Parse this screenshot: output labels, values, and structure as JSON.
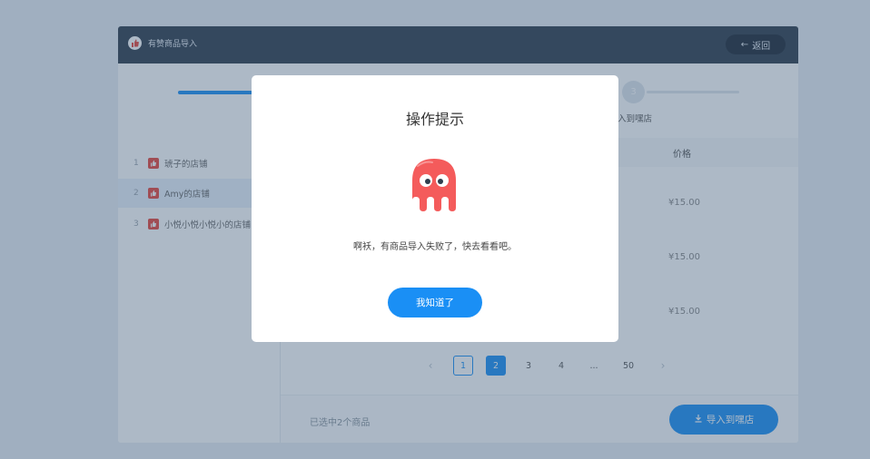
{
  "app": {
    "title": "有赞商品导入",
    "back_label": "返回"
  },
  "stepper": {
    "step3_number": "3",
    "step3_label": "入到嘿店"
  },
  "stores": [
    {
      "num": "1",
      "name": "琥子的店铺"
    },
    {
      "num": "2",
      "name": "Amy的店铺"
    },
    {
      "num": "3",
      "name": "小悦小悦小悦小的店铺"
    }
  ],
  "table": {
    "price_header": "价格",
    "prices": [
      "¥15.00",
      "¥15.00",
      "¥15.00"
    ]
  },
  "pagination": {
    "pages": [
      "1",
      "2",
      "3",
      "4",
      "...",
      "50"
    ]
  },
  "footer": {
    "selected_text": "已选中2个商品",
    "import_label": "导入到嘿店"
  },
  "modal": {
    "title": "操作提示",
    "message": "啊袄，有商品导入失败了，快去看看吧。",
    "ok_label": "我知道了"
  },
  "colors": {
    "primary": "#1a8ff5",
    "titlebar": "#2f3d4d",
    "ghost": "#f45b5b",
    "store_icon": "#e8453c"
  }
}
